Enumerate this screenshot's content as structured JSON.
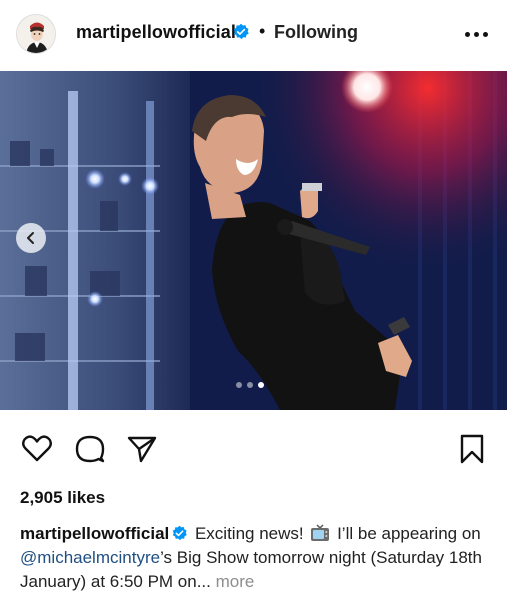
{
  "post": {
    "username": "martipellowofficial",
    "separator": "•",
    "following_label": "Following"
  },
  "carousel": {
    "slide_count": 3,
    "active_index": 2
  },
  "engagement": {
    "likes": "2,905 likes"
  },
  "caption": {
    "username": "martipellowofficial",
    "text_1": " Exciting news! ",
    "text_2": " I’ll be appearing on ",
    "mention": "@michaelmcintyre",
    "text_3": "’s Big Show tomorrow night (Saturday 18th January) at 6:50 PM on...",
    "more_label": " more"
  },
  "colors": {
    "verified_blue": "#0095f6",
    "mention_blue": "#1f4f82",
    "muted_gray": "#8e8e8e"
  },
  "icons": {
    "header": [
      "verified-badge-icon",
      "more-options-icon"
    ],
    "actions": [
      "heart-icon",
      "comment-icon",
      "share-icon",
      "bookmark-icon"
    ],
    "carousel": [
      "chevron-left-icon"
    ],
    "caption": [
      "verified-badge-icon",
      "television-emoji-icon"
    ]
  }
}
